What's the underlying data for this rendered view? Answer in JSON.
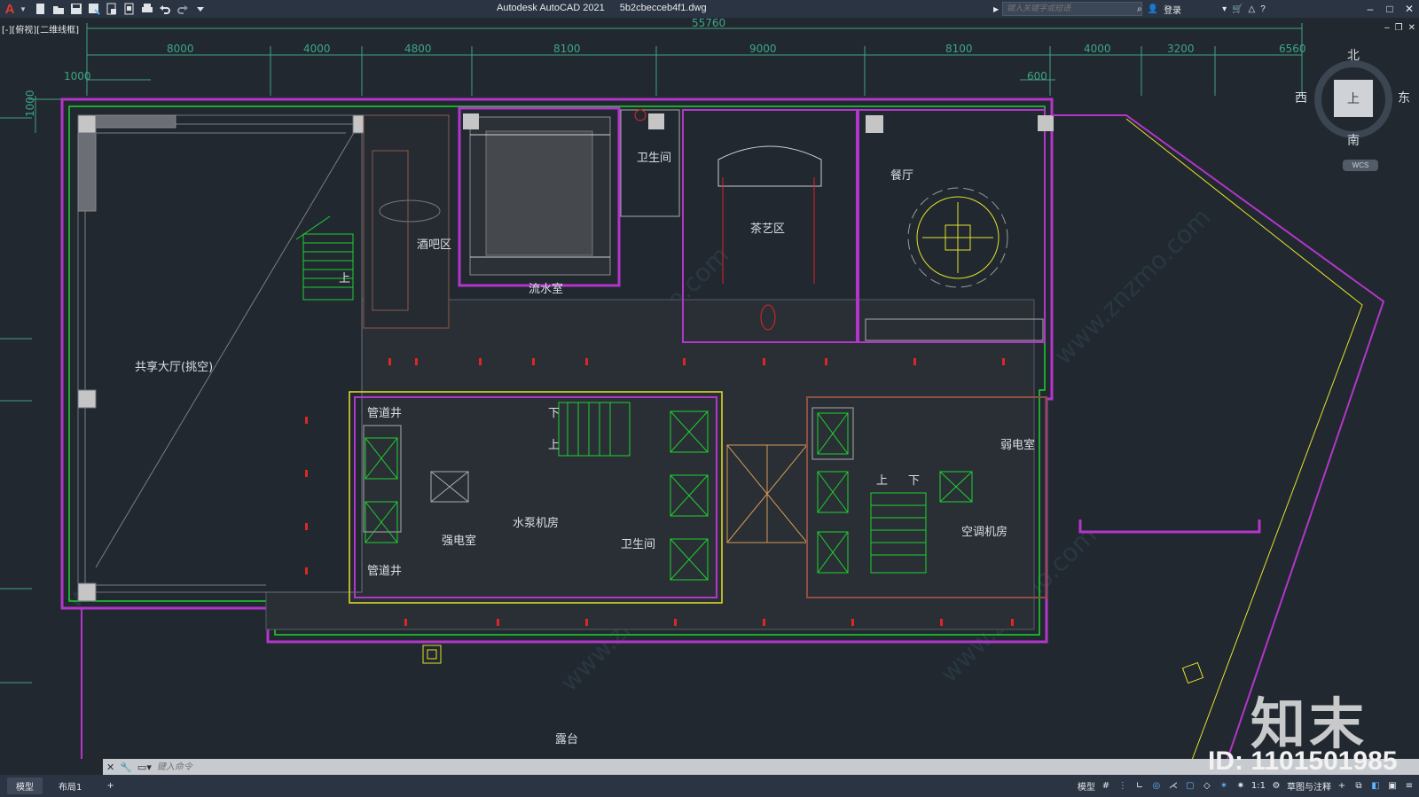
{
  "titlebar": {
    "app_name": "Autodesk AutoCAD 2021",
    "file_name": "5b2cbecceb4f1.dwg",
    "search_placeholder": "键入关键字或短语",
    "login_label": "登录"
  },
  "viewport": {
    "view_label": "[-][俯视][二维线框]"
  },
  "viewcube": {
    "face": "上",
    "north": "北",
    "south": "南",
    "east": "东",
    "west": "西",
    "wcs": "WCS"
  },
  "drawing": {
    "dims_top": [
      "8000",
      "4000",
      "4800",
      "8100",
      "9000",
      "8100",
      "4000",
      "3200",
      "6560"
    ],
    "dim_overall": "55760",
    "dim_left": "1000",
    "dim_right": "600",
    "dim_side": "1000",
    "rooms": {
      "atrium": "共享大厅(挑空)",
      "bar": "酒吧区",
      "water_room": "流水室",
      "wc_top": "卫生间",
      "tea_area": "茶艺区",
      "dining": "餐厅",
      "shaft_top": "管道井",
      "shaft_bottom": "管道井",
      "strong_elec": "强电室",
      "pump_room": "水泵机房",
      "wc_mid": "卫生间",
      "weak_elec": "弱电室",
      "ac_room": "空调机房",
      "terrace": "露台"
    },
    "stair_up": "上",
    "stair_down": "下",
    "watermark": "www.znzmo.com"
  },
  "command": {
    "placeholder": "键入命令"
  },
  "statusbar": {
    "tab_model": "模型",
    "tab_layout1": "布局1",
    "model_label": "模型",
    "scale": "1:1",
    "workspace": "草图与注释"
  },
  "brand": {
    "name": "知末",
    "id": "ID: 1101501985"
  },
  "colors": {
    "background": "#212830",
    "wall_magenta": "#b236c9",
    "green": "#1fd12f",
    "yellow": "#e4e22a",
    "red_dots": "#e02525",
    "dim_green": "#3fa585"
  }
}
